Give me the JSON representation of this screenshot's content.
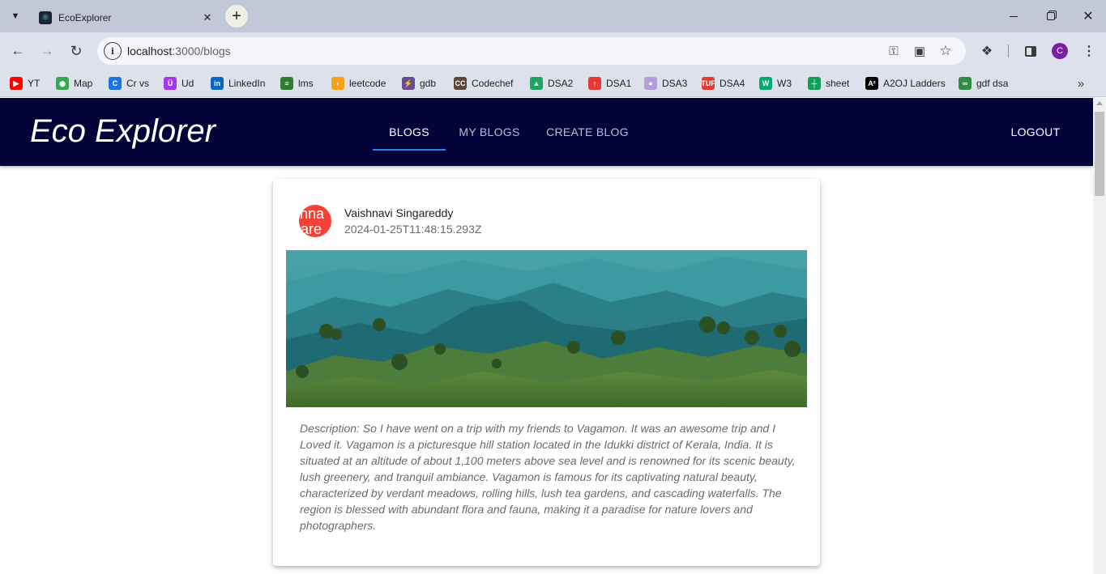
{
  "browser": {
    "tab_title": "EcoExplorer",
    "url_host": "localhost",
    "url_path": ":3000/blogs",
    "profile_initial": "C",
    "bookmarks": [
      {
        "label": "YT",
        "icon": "youtube-icon",
        "color": "#ff0000"
      },
      {
        "label": "Map",
        "icon": "maps-icon",
        "color": "#34a853"
      },
      {
        "label": "Cr vs",
        "icon": "c-icon",
        "color": "#1a73e8"
      },
      {
        "label": "Ud",
        "icon": "udemy-icon",
        "color": "#a435f0"
      },
      {
        "label": "LinkedIn",
        "icon": "linkedin-icon",
        "color": "#0a66c2"
      },
      {
        "label": "lms",
        "icon": "lms-icon",
        "color": "#2e7d32"
      },
      {
        "label": "leetcode",
        "icon": "leetcode-icon",
        "color": "#f89f1b"
      },
      {
        "label": "gdb",
        "icon": "gdb-icon",
        "color": "#6a4c93"
      },
      {
        "label": "Codechef",
        "icon": "codechef-icon",
        "color": "#5b4638"
      },
      {
        "label": "DSA2",
        "icon": "drive-icon",
        "color": "#1fa463"
      },
      {
        "label": "DSA1",
        "icon": "rocket-icon",
        "color": "#e53935"
      },
      {
        "label": "DSA3",
        "icon": "circle-icon",
        "color": "#b39ddb"
      },
      {
        "label": "DSA4",
        "icon": "tuf-icon",
        "color": "#e53935"
      },
      {
        "label": "W3",
        "icon": "w3-icon",
        "color": "#04aa6d"
      },
      {
        "label": "sheet",
        "icon": "sheets-icon",
        "color": "#0f9d58"
      },
      {
        "label": "A2OJ Ladders",
        "icon": "a2oj-icon",
        "color": "#000000"
      },
      {
        "label": "gdf dsa",
        "icon": "gfg-icon",
        "color": "#2f8d46"
      }
    ]
  },
  "app": {
    "brand": "Eco Explorer",
    "nav": {
      "blogs": "BLOGS",
      "my_blogs": "MY BLOGS",
      "create_blog": "CREATE BLOG",
      "logout": "LOGOUT"
    },
    "colors": {
      "header_bg": "#03033a",
      "accent": "#2f80ed",
      "avatar": "#f44336"
    }
  },
  "post": {
    "avatar_line1": "shna",
    "avatar_line2": "nare",
    "author": "Vaishnavi Singareddy",
    "date": "2024-01-25T11:48:15.293Z",
    "image_alt": "Vagamon green hills landscape",
    "description": "Description: So I have went on a trip with my friends to Vagamon. It was an awesome trip and I Loved it. Vagamon is a picturesque hill station located in the Idukki district of Kerala, India. It is situated at an altitude of about 1,100 meters above sea level and is renowned for its scenic beauty, lush greenery, and tranquil ambiance. Vagamon is famous for its captivating natural beauty, characterized by verdant meadows, rolling hills, lush tea gardens, and cascading waterfalls. The region is blessed with abundant flora and fauna, making it a paradise for nature lovers and photographers."
  }
}
